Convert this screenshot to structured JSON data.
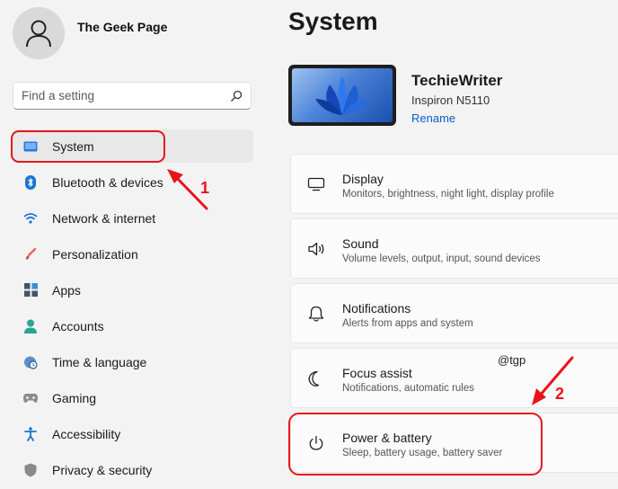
{
  "user": {
    "name": "The Geek Page"
  },
  "search": {
    "placeholder": "Find a setting"
  },
  "sidebar": {
    "items": [
      {
        "label": "System"
      },
      {
        "label": "Bluetooth & devices"
      },
      {
        "label": "Network & internet"
      },
      {
        "label": "Personalization"
      },
      {
        "label": "Apps"
      },
      {
        "label": "Accounts"
      },
      {
        "label": "Time & language"
      },
      {
        "label": "Gaming"
      },
      {
        "label": "Accessibility"
      },
      {
        "label": "Privacy & security"
      }
    ]
  },
  "main": {
    "title": "System",
    "device": {
      "name": "TechieWriter",
      "model": "Inspiron N5110",
      "rename_label": "Rename"
    },
    "cards": [
      {
        "title": "Display",
        "subtitle": "Monitors, brightness, night light, display profile",
        "icon": "monitor-icon"
      },
      {
        "title": "Sound",
        "subtitle": "Volume levels, output, input, sound devices",
        "icon": "speaker-icon"
      },
      {
        "title": "Notifications",
        "subtitle": "Alerts from apps and system",
        "icon": "bell-icon"
      },
      {
        "title": "Focus assist",
        "subtitle": "Notifications, automatic rules",
        "icon": "moon-icon"
      },
      {
        "title": "Power & battery",
        "subtitle": "Sleep, battery usage, battery saver",
        "icon": "power-icon"
      }
    ]
  },
  "annotations": {
    "step1": "1",
    "step2": "2",
    "watermark": "@tgp"
  },
  "colors": {
    "accent": "#0a5ec7",
    "callout": "#e8141b",
    "background": "#f3f3f3"
  }
}
